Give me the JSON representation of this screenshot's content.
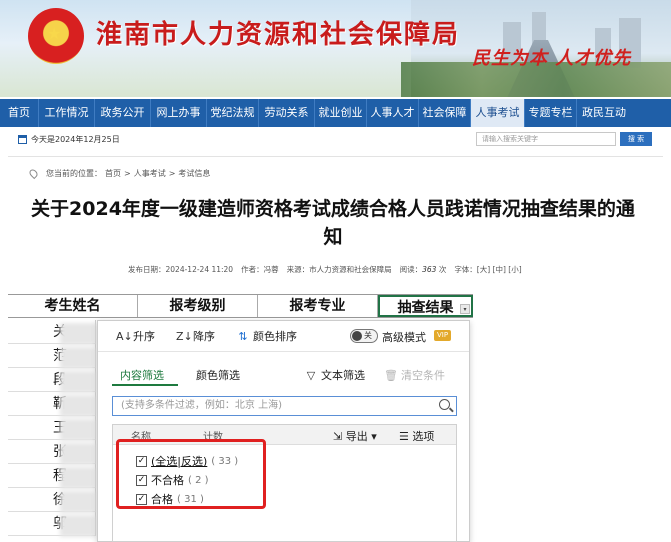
{
  "site": {
    "title": "淮南市人力资源和社会保障局",
    "slogan": "民生为本  人才优先"
  },
  "nav": [
    "首页",
    "工作情况",
    "政务公开",
    "网上办事",
    "党纪法规",
    "劳动关系",
    "就业创业",
    "人事人才",
    "社会保障",
    "人事考试",
    "专题专栏",
    "政民互动"
  ],
  "nav_active_index": 9,
  "topbar": {
    "date": "今天是2024年12月25日",
    "search_placeholder": "请输入搜索关键字",
    "search_button": "搜 索"
  },
  "breadcrumb": [
    "您当前的位置：",
    "首页",
    ">",
    "人事考试",
    ">",
    "考试信息"
  ],
  "article": {
    "title": "关于2024年度一级建造师资格考试成绩合格人员践诺情况抽查结果的通知",
    "meta": {
      "publish": "发布日期：2024-12-24 11:20",
      "author": "作者：冯蓉",
      "source": "来源：市人力资源和社会保障局",
      "views_label": "阅读：",
      "views": "363",
      "views_unit": "次",
      "font": "字体：[大] [中] [小]"
    }
  },
  "sheet": {
    "headers": [
      "考生姓名",
      "报考级别",
      "报考专业",
      "抽查结果"
    ],
    "names": [
      "关",
      "范",
      "段",
      "靳",
      "王",
      "张",
      "程",
      "徐",
      "邬"
    ]
  },
  "filter_panel": {
    "sort_asc": "升序",
    "sort_desc": "降序",
    "sort_color": "颜色排序",
    "toggle_text": "关",
    "advanced": "高级模式",
    "vip": "VIP",
    "tab_content": "内容筛选",
    "tab_color": "颜色筛选",
    "text_filter": "文本筛选",
    "clear": "清空条件",
    "input_placeholder": "(支持多条件过滤，例如：北京  上海)",
    "col_name": "名称",
    "col_count": "计数",
    "export": "导出",
    "options_btn": "选项",
    "options": [
      {
        "label": "(全选|反选)",
        "count": "( 33 )",
        "checked": true
      },
      {
        "label": "不合格",
        "count": "( 2 )",
        "checked": true
      },
      {
        "label": "合格",
        "count": "( 31 )",
        "checked": true
      }
    ]
  }
}
